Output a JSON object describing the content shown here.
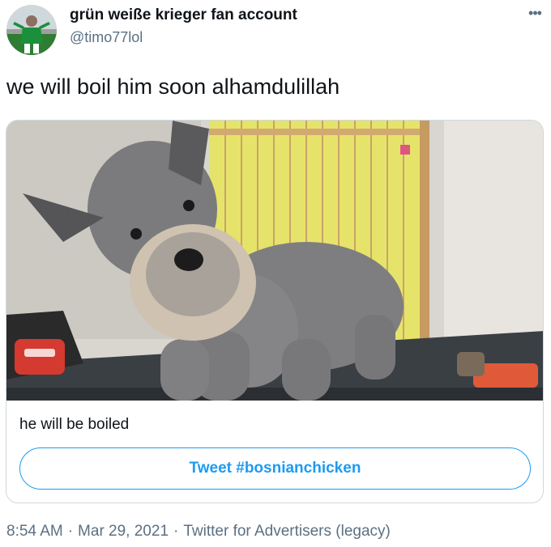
{
  "author": {
    "display_name": "grün weiße krieger fan account",
    "handle": "@timo77lol"
  },
  "tweet": {
    "text": "we will boil him soon alhamdulillah"
  },
  "card": {
    "caption": "he will be boiled",
    "button_label": "Tweet #bosnianchicken"
  },
  "meta": {
    "time": "8:54 AM",
    "date": "Mar 29, 2021",
    "source": "Twitter for Advertisers (legacy)",
    "separator": "·"
  },
  "icons": {
    "more": "more-horizontal-icon"
  },
  "colors": {
    "accent": "#1d9bf0",
    "secondary_text": "#5b7083",
    "border": "#cfd9de"
  }
}
